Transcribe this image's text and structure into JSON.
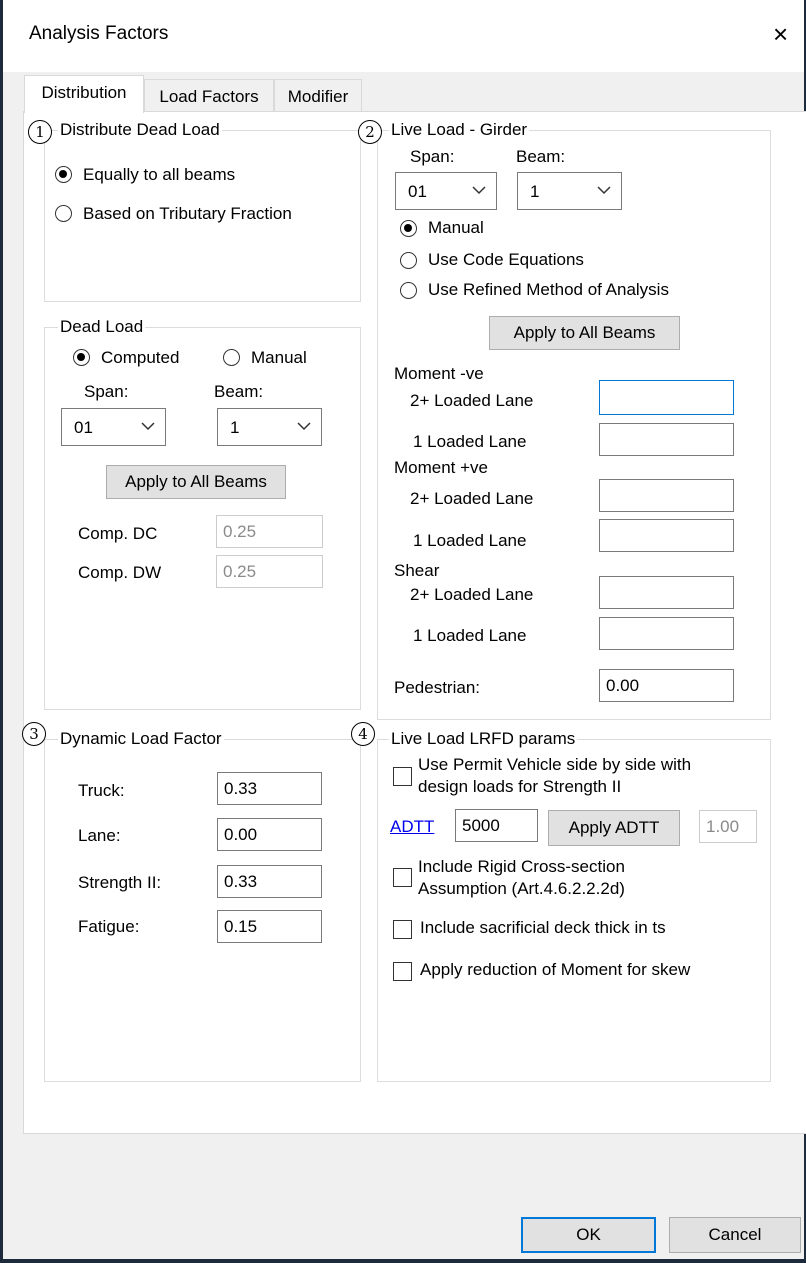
{
  "window": {
    "title": "Analysis Factors",
    "close_glyph": "×"
  },
  "tabs": [
    "Distribution",
    "Load Factors",
    "Modifier"
  ],
  "markers": [
    "1",
    "2",
    "3",
    "4"
  ],
  "distribute_dead_load": {
    "legend": "Distribute Dead Load",
    "options": [
      "Equally to all beams",
      "Based on Tributary Fraction"
    ],
    "selected": "Equally to all beams"
  },
  "dead_load": {
    "legend": "Dead Load",
    "computed_label": "Computed",
    "manual_label": "Manual",
    "selected": "Computed",
    "span_label": "Span:",
    "beam_label": "Beam:",
    "span_value": "01",
    "beam_value": "1",
    "apply_label": "Apply to All Beams",
    "comp_dc_label": "Comp. DC",
    "comp_dc_value": "0.25",
    "comp_dw_label": "Comp. DW",
    "comp_dw_value": "0.25"
  },
  "live_load_girder": {
    "legend": "Live Load - Girder",
    "span_label": "Span:",
    "beam_label": "Beam:",
    "span_value": "01",
    "beam_value": "1",
    "options": [
      "Manual",
      "Use Code Equations",
      "Use Refined Method of Analysis"
    ],
    "selected": "Manual",
    "apply_label": "Apply to All Beams",
    "moment_neg_label": "Moment -ve",
    "moment_pos_label": "Moment +ve",
    "shear_label": "Shear",
    "two_lane_label": "2+ Loaded Lane",
    "one_lane_label": "1 Loaded Lane",
    "moment_neg_2": "",
    "moment_neg_1": "",
    "moment_pos_2": "",
    "moment_pos_1": "",
    "shear_2": "",
    "shear_1": "",
    "pedestrian_label": "Pedestrian:",
    "pedestrian_value": "0.00"
  },
  "dynamic_load_factor": {
    "legend": "Dynamic Load Factor",
    "truck_label": "Truck:",
    "truck_value": "0.33",
    "lane_label": "Lane:",
    "lane_value": "0.00",
    "strength_label": "Strength II:",
    "strength_value": "0.33",
    "fatigue_label": "Fatigue:",
    "fatigue_value": "0.15"
  },
  "lrfd_params": {
    "legend": "Live Load LRFD params",
    "permit_line1": "Use Permit Vehicle side by side with",
    "permit_line2": "design loads for Strength II",
    "adtt_link": "ADTT",
    "adtt_value": "5000",
    "apply_adtt_label": "Apply ADTT",
    "adtt_factor": "1.00",
    "rigid_line1": "Include Rigid Cross-section",
    "rigid_line2": "Assumption (Art.4.6.2.2.2d)",
    "sacrificial_label": "Include sacrificial deck thick in ts",
    "skew_label": "Apply reduction of Moment for skew"
  },
  "footer": {
    "ok_label": "OK",
    "cancel_label": "Cancel"
  }
}
